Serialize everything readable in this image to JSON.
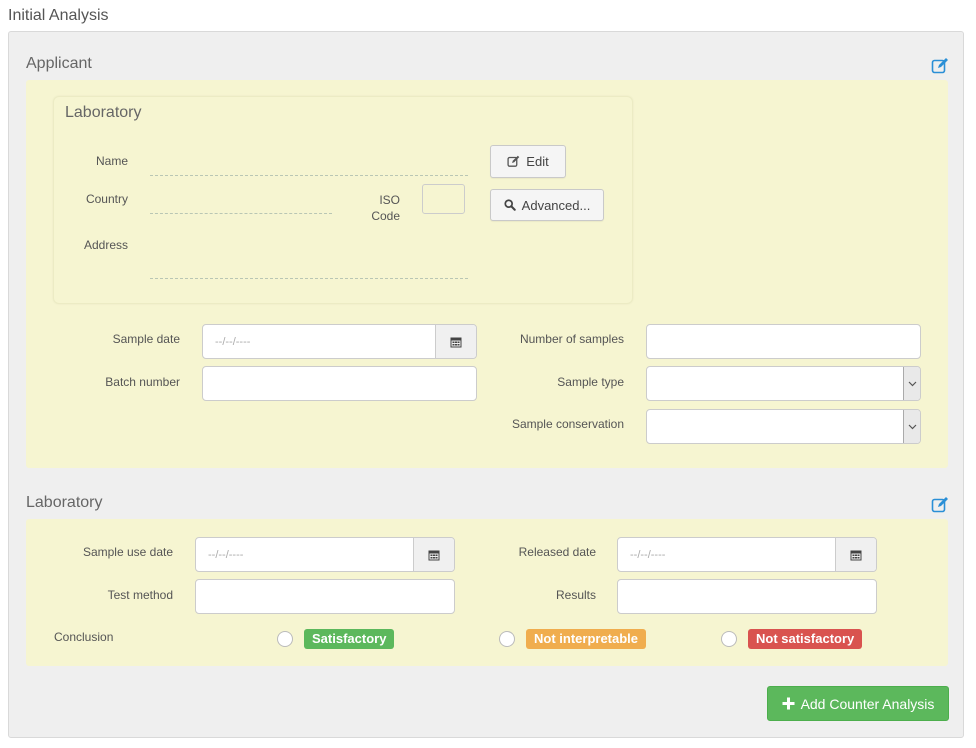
{
  "page_title": "Initial Analysis",
  "applicant": {
    "title": "Applicant",
    "laboratory_box": {
      "title": "Laboratory",
      "name_label": "Name",
      "country_label": "Country",
      "iso_label_line1": "ISO",
      "iso_label_line2": "Code",
      "address_label": "Address",
      "edit_button": "Edit",
      "advanced_button": "Advanced..."
    },
    "sample_date_label": "Sample date",
    "sample_date_placeholder": "--/--/----",
    "batch_number_label": "Batch number",
    "number_of_samples_label": "Number of samples",
    "sample_type_label": "Sample type",
    "sample_conservation_label": "Sample conservation"
  },
  "laboratory": {
    "title": "Laboratory",
    "sample_use_date_label": "Sample use date",
    "sample_use_date_placeholder": "--/--/----",
    "released_date_label": "Released date",
    "released_date_placeholder": "--/--/----",
    "test_method_label": "Test method",
    "results_label": "Results",
    "conclusion_label": "Conclusion",
    "options": [
      "Satisfactory",
      "Not interpretable",
      "Not satisfactory"
    ]
  },
  "add_counter_analysis_button": "Add Counter Analysis",
  "colors": {
    "accent_blue": "#2a8fd6",
    "success": "#5cb85c",
    "warning": "#f0ad4e",
    "danger": "#d9534f",
    "panel_yellow": "#f6f5d1"
  },
  "icons": {
    "section_edit": "edit-square-icon",
    "calendar": "calendar-icon",
    "search": "search-icon",
    "plus": "plus-icon",
    "dropdown": "chevron-down-icon"
  }
}
